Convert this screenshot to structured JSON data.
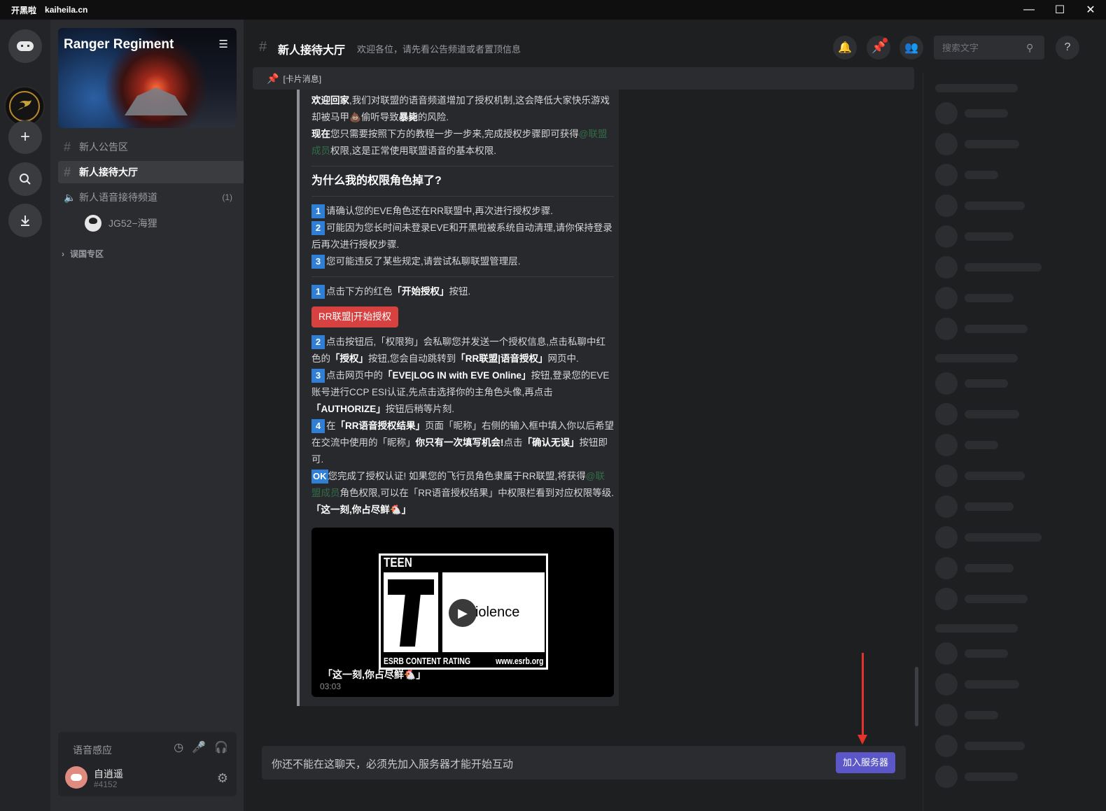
{
  "titlebar": {
    "app_name": "开黑啦",
    "domain": "kaiheila.cn"
  },
  "sidebar": {
    "guild_name": "Ranger Regiment",
    "channels": [
      {
        "name": "新人公告区"
      },
      {
        "name": "新人接待大厅"
      },
      {
        "name": "新人语音接待频道",
        "count": "(1)"
      }
    ],
    "voice_user": "JG52−海狸",
    "category": "误国专区",
    "user_panel": {
      "voice_mode": "语音感应",
      "username": "自逍遥",
      "tag": "#4152"
    }
  },
  "header": {
    "channel_name": "新人接待大厅",
    "topic": "欢迎各位，请先看公告频道或者置顶信息",
    "search_placeholder": "搜索文字"
  },
  "card": {
    "label": "[卡片消息]",
    "p1_bold": "欢迎回家",
    "p1_rest": ",我们对联盟的语音频道增加了授权机制,这会降低大家快乐游戏却被马甲",
    "p1_tail": "偷听导致",
    "p1_bold2": "暴毙",
    "p1_end": "的风险.",
    "p2_bold": "现在",
    "p2_rest": "您只需要按照下方的教程一步一步来,完成授权步骤即可获得",
    "p2_green": "@联盟成员",
    "p2_end": "权限,这是正常使用联盟语音的基本权限.",
    "why_title": "为什么我的权限角色掉了?",
    "reasons": [
      {
        "n": "1",
        "text": "请确认您的EVE角色还在RR联盟中,再次进行授权步骤."
      },
      {
        "n": "2",
        "text": "可能因为您长时间未登录EVE和开黑啦被系统自动清理,请你保持登录后再次进行授权步骤."
      },
      {
        "n": "3",
        "text": "您可能违反了某些规定,请尝试私聊联盟管理层."
      }
    ],
    "step1_n": "1",
    "step1_a": "点击下方的红色",
    "step1_b": "「开始授权」",
    "step1_c": "按钮.",
    "auth_button": "RR联盟|开始授权",
    "step2_n": "2",
    "step2_a": "点击按钮后,「权限狗」会私聊您并发送一个授权信息,点击私聊中红色的",
    "step2_b": "「授权」",
    "step2_c": "按钮,您会自动跳转到",
    "step2_d": "「RR联盟|语音授权」",
    "step2_e": "网页中.",
    "step3_n": "3",
    "step3_a": "点击网页中的",
    "step3_b": "「EVE|LOG IN with EVE Online」",
    "step3_c": "按钮,登录您的EVE账号进行CCP ESI认证,先点击选择你的主角色头像,再点击",
    "step3_d": "「AUTHORIZE」",
    "step3_e": "按钮后稍等片刻.",
    "step4_n": "4",
    "step4_a": "在",
    "step4_b": "「RR语音授权结果」",
    "step4_c": "页面「昵称」右侧的输入框中填入你以后希望在交流中使用的「昵称」",
    "step4_d": "你只有一次填写机会!",
    "step4_e": "点击",
    "step4_f": "「确认无误」",
    "step4_g": "按钮即可.",
    "ok_label": "OK",
    "ok_a": "您完成了授权认证! 如果您的飞行员角色隶属于RR联盟,将获得",
    "ok_green": "@联盟成员",
    "ok_b": "角色权限,可以在「RR语音授权结果」中权限栏看到对应权限等级.",
    "ok_c": "「这一刻,你占尽鲜",
    "ok_d": "」",
    "video": {
      "rating_top": "TEEN",
      "rating_letter": "T",
      "rating_desc": "Violence",
      "rating_footer": "ESRB CONTENT RATING",
      "rating_url": "www.esrb.org",
      "caption": "「这一刻,你占尽鲜",
      "caption_end": "」",
      "duration": "03:03"
    }
  },
  "composer": {
    "text": "你还不能在这聊天，必须先加入服务器才能开始互动",
    "join_button": "加入服务器"
  }
}
